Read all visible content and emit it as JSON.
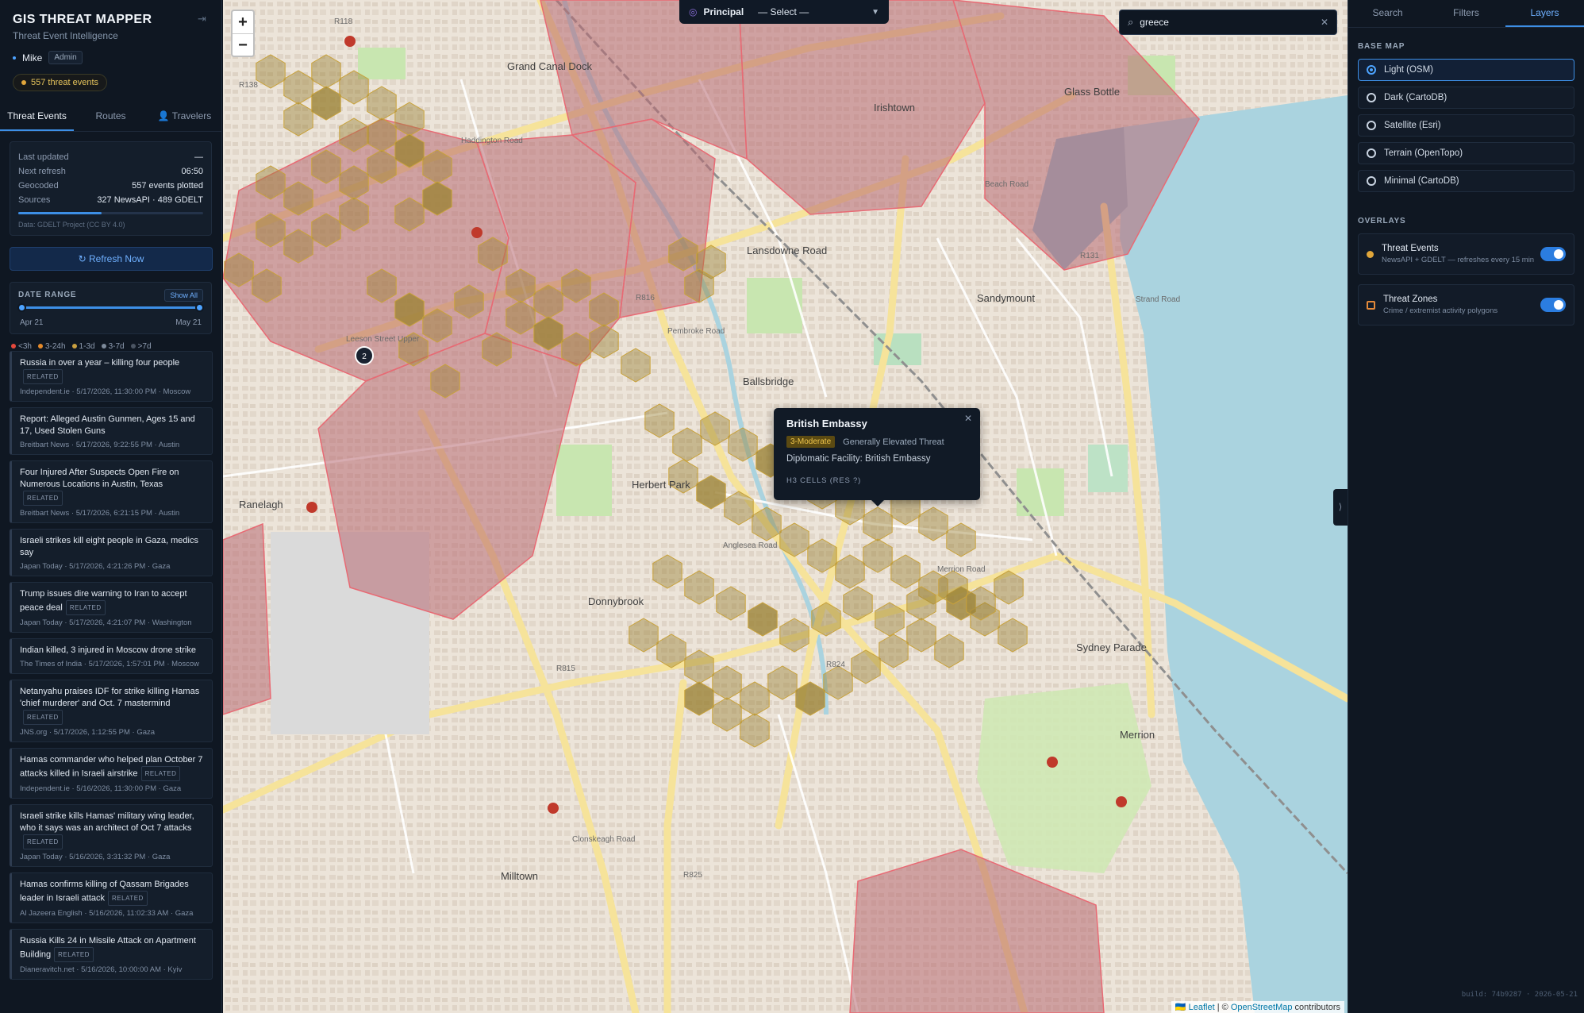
{
  "app": {
    "title": "GIS THREAT MAPPER",
    "subtitle": "Threat Event Intelligence",
    "user": "Mike",
    "role": "Admin",
    "event_count": "557 threat events"
  },
  "left_tabs": [
    "Threat Events",
    "Routes",
    "Travelers"
  ],
  "status": {
    "rows": [
      {
        "k": "Last updated",
        "v": "—"
      },
      {
        "k": "Next refresh",
        "v": "06:50"
      },
      {
        "k": "Geocoded",
        "v": "557 events plotted"
      },
      {
        "k": "Sources",
        "v": "327 NewsAPI · 489 GDELT"
      }
    ],
    "source_note": "Data: GDELT Project (CC BY 4.0)",
    "progress_fraction": 0.45
  },
  "refresh_label": "↻ Refresh Now",
  "date_range": {
    "label": "DATE RANGE",
    "show_all": "Show All",
    "start": "Apr 21",
    "end": "May 21"
  },
  "age_legend": [
    {
      "label": "<3h",
      "color": "#e5483c"
    },
    {
      "label": "3-24h",
      "color": "#e58a2a"
    },
    {
      "label": "1-3d",
      "color": "#c9a040"
    },
    {
      "label": "3-7d",
      "color": "#7d8a9a"
    },
    {
      "label": ">7d",
      "color": "#4b5563"
    }
  ],
  "feed": [
    {
      "title": "Russia in over a year – killing four people",
      "related": "RELATED",
      "meta": "Independent.ie · 5/17/2026, 11:30:00 PM · Moscow"
    },
    {
      "title": "Report: Alleged Austin Gunmen, Ages 15 and 17, Used Stolen Guns",
      "related": "",
      "meta": "Breitbart News · 5/17/2026, 9:22:55 PM · Austin"
    },
    {
      "title": "Four Injured After Suspects Open Fire on Numerous Locations in Austin, Texas",
      "related": "RELATED",
      "meta": "Breitbart News · 5/17/2026, 6:21:15 PM · Austin"
    },
    {
      "title": "Israeli strikes kill eight people in Gaza, medics say",
      "related": "",
      "meta": "Japan Today · 5/17/2026, 4:21:26 PM · Gaza"
    },
    {
      "title": "Trump issues dire warning to Iran to accept peace deal",
      "related": "RELATED",
      "meta": "Japan Today · 5/17/2026, 4:21:07 PM · Washington"
    },
    {
      "title": "Indian killed, 3 injured in Moscow drone strike",
      "related": "",
      "meta": "The Times of India · 5/17/2026, 1:57:01 PM · Moscow"
    },
    {
      "title": "Netanyahu praises IDF for strike killing Hamas 'chief murderer' and Oct. 7 mastermind",
      "related": "RELATED",
      "meta": "JNS.org · 5/17/2026, 1:12:55 PM · Gaza"
    },
    {
      "title": "Hamas commander who helped plan October 7 attacks killed in Israeli airstrike",
      "related": "RELATED",
      "meta": "Independent.ie · 5/16/2026, 11:30:00 PM · Gaza"
    },
    {
      "title": "Israeli strike kills Hamas' military wing leader, who it says was an architect of Oct 7 attacks",
      "related": "RELATED",
      "meta": "Japan Today · 5/16/2026, 3:31:32 PM · Gaza"
    },
    {
      "title": "Hamas confirms killing of Qassam Brigades leader in Israeli attack",
      "related": "RELATED",
      "meta": "Al Jazeera English · 5/16/2026, 11:02:33 AM · Gaza"
    },
    {
      "title": "Russia Kills 24 in Missile Attack on Apartment Building",
      "related": "RELATED",
      "meta": "Dianeravitch.net · 5/16/2026, 10:00:00 AM · Kyiv"
    }
  ],
  "map": {
    "zoom_in": "+",
    "zoom_out": "−",
    "principal_label": "Principal",
    "principal_value": "— Select —",
    "search_value": "greece",
    "cluster_count": "2",
    "place_labels": [
      "Irishtown",
      "Sandymount",
      "Ballsbridge",
      "Ranelagh",
      "Donnybrook",
      "Merrion",
      "Milltown",
      "Lansdowne Road",
      "Sydney Parade",
      "Herbert Park",
      "Glass Bottle",
      "Grand Canal Dock",
      "Beach Road",
      "Strand Road",
      "Merrion Road",
      "Pembroke Road",
      "Haddington Road",
      "Leeson Street Upper",
      "Clonskeagh Road",
      "Anglesea Road",
      "R118",
      "R815",
      "R131",
      "R824",
      "R825",
      "R138",
      "R816"
    ],
    "attribution_leaflet": "🇺🇦 Leaflet",
    "attribution_sep": " | © ",
    "attribution_osm": "OpenStreetMap",
    "attribution_tail": " contributors"
  },
  "popup": {
    "title": "British Embassy",
    "badge": "3-Moderate",
    "level": "Generally Elevated Threat",
    "desc": "Diplomatic Facility: British Embassy",
    "h3": "H3 CELLS (RES ?)"
  },
  "right_tabs": [
    "Search",
    "Filters",
    "Layers"
  ],
  "base_map": {
    "title": "BASE MAP",
    "options": [
      "Light (OSM)",
      "Dark (CartoDB)",
      "Satellite (Esri)",
      "Terrain (OpenTopo)",
      "Minimal (CartoDB)"
    ],
    "selected": 0
  },
  "overlays": {
    "title": "OVERLAYS",
    "items": [
      {
        "name": "Threat Events",
        "desc": "NewsAPI + GDELT — refreshes every 15 min"
      },
      {
        "name": "Threat Zones",
        "desc": "Crime / extremist activity polygons"
      }
    ]
  },
  "build": "build: 74b9287 · 2026-05-21",
  "colors": {
    "accent": "#3d8fe6",
    "zone_fill": "#c9707a",
    "hex_fill": "#a78a3a",
    "water": "#aad3df"
  }
}
